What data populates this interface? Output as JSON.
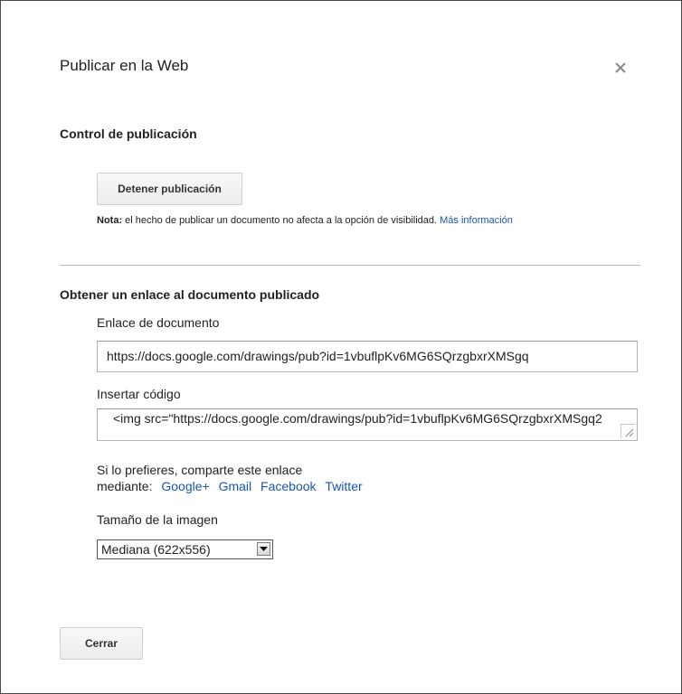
{
  "dialog": {
    "title": "Publicar en la Web",
    "close_icon": "close-icon"
  },
  "publishing_control": {
    "heading": "Control de publicación",
    "stop_button": "Detener publicación",
    "note_label": "Nota:",
    "note_text": " el hecho de publicar un documento no afecta a la opción de visibilidad.",
    "note_link": "Más información"
  },
  "link_section": {
    "heading": "Obtener un enlace al documento publicado",
    "doc_link_label": "Enlace de documento",
    "doc_link_value": "https://docs.google.com/drawings/pub?id=1vbuflpKv6MG6SQrzgbxrXMSgq",
    "embed_label": "Insertar código",
    "embed_value": "<img src=\"https://docs.google.com/drawings/pub?id=1vbuflpKv6MG6SQrzgbxrXMSgq2",
    "share_line1": "Si lo prefieres, comparte este enlace",
    "share_line2": "mediante:",
    "share_links": [
      "Google+",
      "Gmail",
      "Facebook",
      "Twitter"
    ],
    "image_size_label": "Tamaño de la imagen",
    "image_size_selected": "Mediana (622x556)"
  },
  "footer": {
    "close_button": "Cerrar"
  },
  "colors": {
    "link": "#1a55b5",
    "text": "#222222",
    "divider": "#b7b7b7"
  }
}
